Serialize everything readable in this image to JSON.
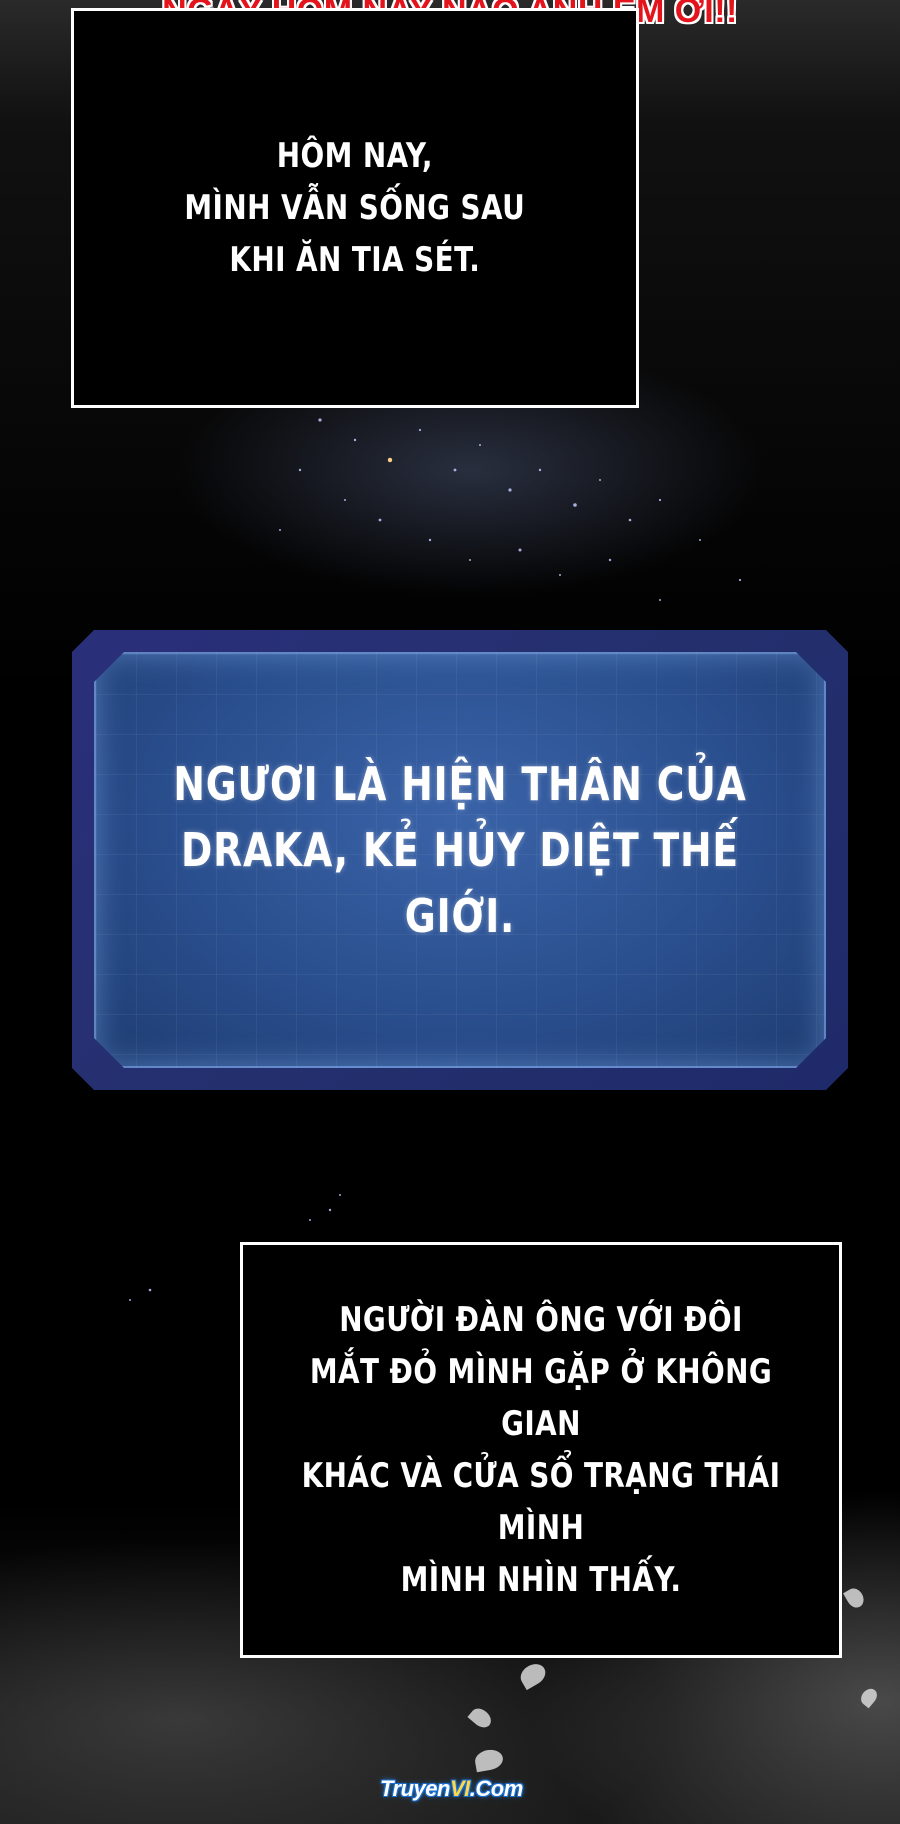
{
  "banner": {
    "text": "NGÀY HÔM NAY NÀO ANH EM ƠI!!"
  },
  "caption_top": {
    "lines": [
      "HÔM NAY,",
      "MÌNH VẪN SỐNG SAU",
      "KHI ĂN TIA SÉT."
    ]
  },
  "system_window": {
    "lines": [
      "NGƯƠI LÀ HIỆN THÂN CỦA",
      "DRAKA, KẺ HỦY DIỆT THẾ GIỚI."
    ]
  },
  "caption_bottom": {
    "lines": [
      "NGƯỜI ĐÀN ÔNG VỚI ĐÔI",
      "MẮT ĐỎ MÌNH GẶP Ở KHÔNG GIAN",
      "KHÁC VÀ CỬA SỔ TRẠNG THÁI MÌNH",
      "MÌNH NHÌN THẤY."
    ]
  },
  "watermark": {
    "prefix": "Truyen",
    "accent": "VI",
    "suffix": ".Com"
  },
  "colors": {
    "banner_text": "#e3141c",
    "caption_border": "#ffffff",
    "system_window_blue": "#2a4f8e"
  }
}
